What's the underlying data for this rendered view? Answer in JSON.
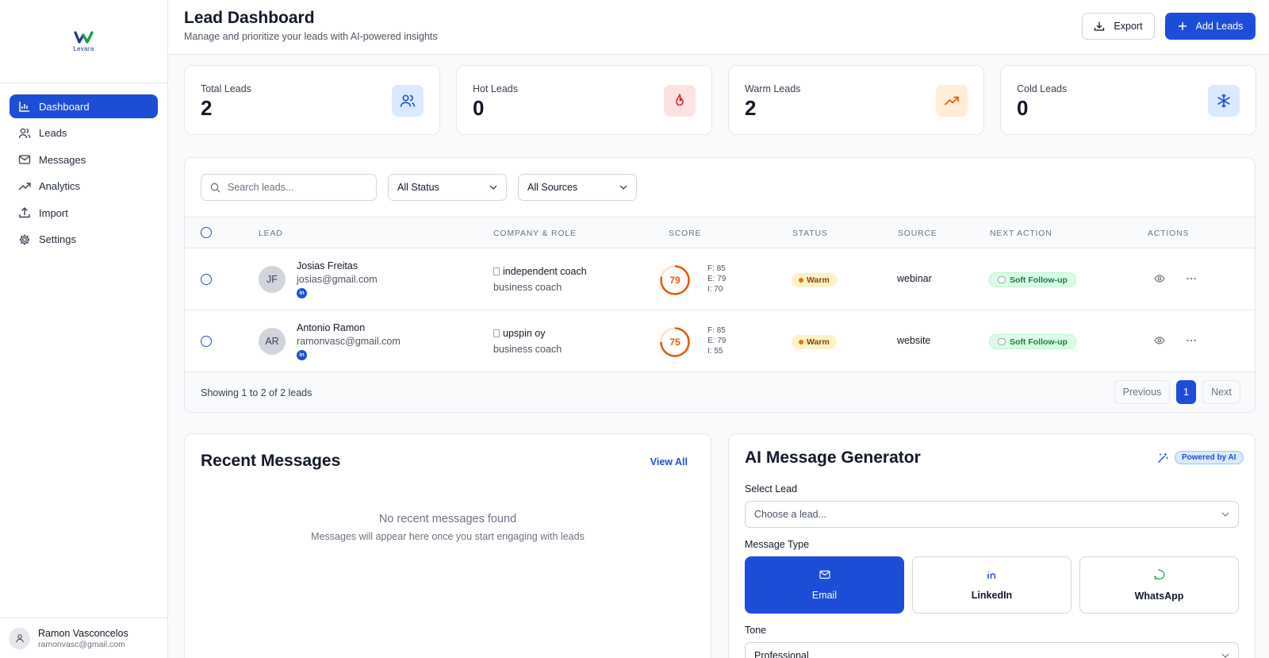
{
  "brand": {
    "logo_text": "Levara",
    "accent": "#1d4ed8"
  },
  "sidebar": {
    "items": [
      {
        "label": "Dashboard",
        "icon": "bar-chart-icon",
        "active": true
      },
      {
        "label": "Leads",
        "icon": "users-icon"
      },
      {
        "label": "Messages",
        "icon": "mail-icon"
      },
      {
        "label": "Analytics",
        "icon": "trending-up-icon"
      },
      {
        "label": "Import",
        "icon": "upload-icon"
      },
      {
        "label": "Settings",
        "icon": "gear-icon"
      }
    ],
    "user": {
      "name": "Ramon Vasconcelos",
      "email": "ramonvasc@gmail.com"
    }
  },
  "header": {
    "title": "Lead Dashboard",
    "subtitle": "Manage and prioritize your leads with AI-powered insights",
    "export_label": "Export",
    "add_label": "Add Leads"
  },
  "stats": [
    {
      "label": "Total Leads",
      "value": "2",
      "icon": "users-icon"
    },
    {
      "label": "Hot Leads",
      "value": "0",
      "icon": "flame-icon"
    },
    {
      "label": "Warm Leads",
      "value": "2",
      "icon": "trending-up-icon"
    },
    {
      "label": "Cold Leads",
      "value": "0",
      "icon": "snowflake-icon"
    }
  ],
  "filters": {
    "search_placeholder": "Search leads...",
    "status_selected": "All Status",
    "source_selected": "All Sources"
  },
  "table": {
    "columns": [
      "LEAD",
      "COMPANY & ROLE",
      "SCORE",
      "STATUS",
      "SOURCE",
      "NEXT ACTION",
      "ACTIONS"
    ],
    "rows": [
      {
        "initials": "JF",
        "name": "Josias Freitas",
        "email": "josias@gmail.com",
        "company": "independent coach",
        "role": "business coach",
        "score": "79",
        "score_value": 79,
        "f": "F: 85",
        "e": "E: 79",
        "i": "I: 70",
        "status": "Warm",
        "source": "webinar",
        "next_action": "Soft Follow-up"
      },
      {
        "initials": "AR",
        "name": "Antonio Ramon",
        "email": "ramonvasc@gmail.com",
        "company": "upspin oy",
        "role": "business coach",
        "score": "75",
        "score_value": 75,
        "f": "F: 85",
        "e": "E: 79",
        "i": "I: 55",
        "status": "Warm",
        "source": "website",
        "next_action": "Soft Follow-up"
      }
    ],
    "showing": "Showing 1 to 2 of 2 leads",
    "pagination": {
      "previous": "Previous",
      "current": "1",
      "next": "Next"
    }
  },
  "recent_messages": {
    "title": "Recent Messages",
    "view_all": "View All",
    "empty_title": "No recent messages found",
    "empty_sub": "Messages will appear here once you start engaging with leads"
  },
  "ai_generator": {
    "title": "AI Message Generator",
    "badge": "Powered by AI",
    "select_lead_label": "Select Lead",
    "select_lead_placeholder": "Choose a lead...",
    "message_type_label": "Message Type",
    "types": [
      {
        "label": "Email",
        "icon": "mail-icon",
        "active": true
      },
      {
        "label": "LinkedIn",
        "icon": "linkedin-icon"
      },
      {
        "label": "WhatsApp",
        "icon": "chat-icon"
      }
    ],
    "tone_label": "Tone",
    "tone_selected": "Professional"
  }
}
